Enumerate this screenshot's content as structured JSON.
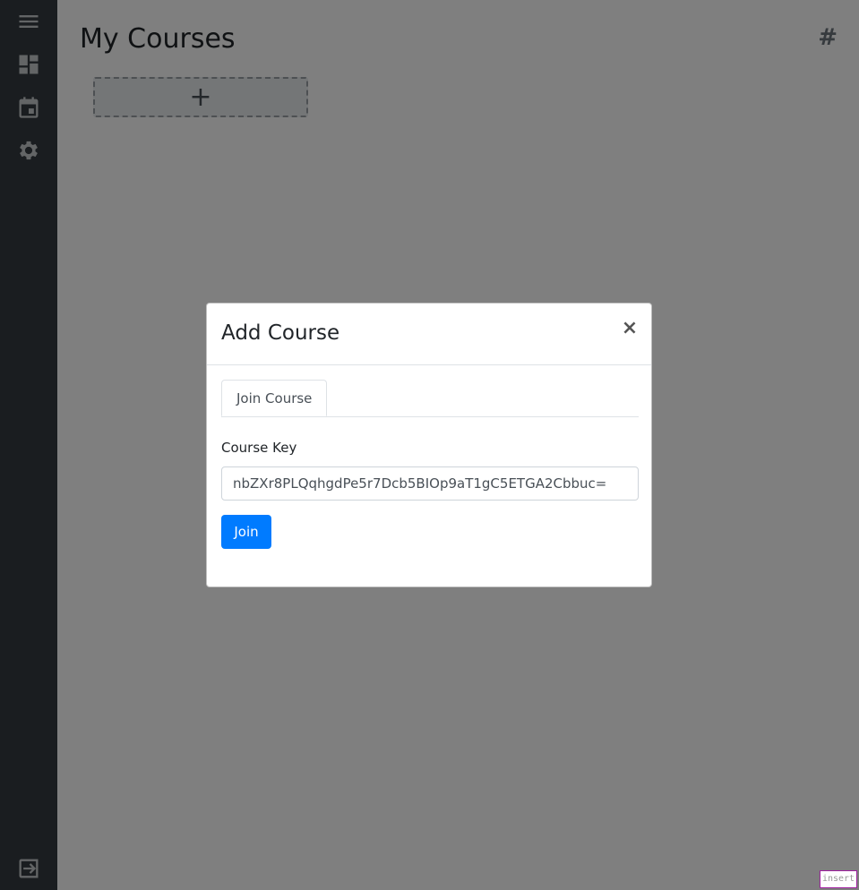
{
  "sidebar": {
    "items": [
      {
        "icon": "menu-icon"
      },
      {
        "icon": "dashboard-icon"
      },
      {
        "icon": "calendar-icon"
      },
      {
        "icon": "gear-icon"
      }
    ],
    "bottom": {
      "icon": "logout-icon"
    }
  },
  "main": {
    "title": "My Courses",
    "hash_label": "#",
    "add_tile_symbol": "+"
  },
  "modal": {
    "title": "Add Course",
    "close_symbol": "×",
    "tabs": [
      {
        "label": "Join Course",
        "active": true
      }
    ],
    "field_label": "Course Key",
    "key_value": "nbZXr8PLQqhgdPe5r7Dcb5BIOp9aT1gC5ETGA2Cbbuc=",
    "join_label": "Join"
  },
  "status": {
    "mode": "insert"
  },
  "colors": {
    "sidebar_bg": "#343a40",
    "primary": "#007bff",
    "backdrop": "rgba(0,0,0,0.5)"
  }
}
